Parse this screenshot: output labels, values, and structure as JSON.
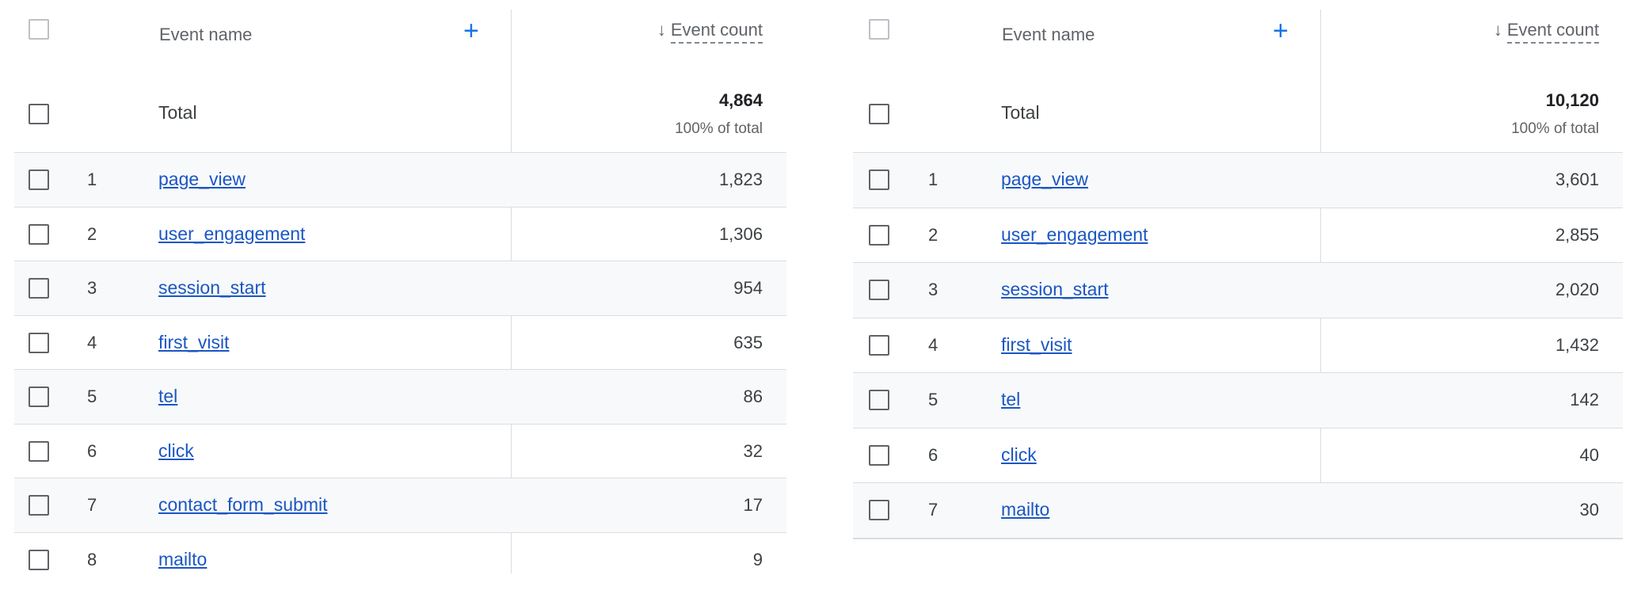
{
  "tables": [
    {
      "header": {
        "name_label": "Event name",
        "add_label": "+",
        "sort_arrow": "↓",
        "metric_label": "Event count"
      },
      "total": {
        "label": "Total",
        "value": "4,864",
        "percent": "100% of total"
      },
      "rows": [
        {
          "index": "1",
          "name": "page_view",
          "count": "1,823"
        },
        {
          "index": "2",
          "name": "user_engagement",
          "count": "1,306"
        },
        {
          "index": "3",
          "name": "session_start",
          "count": "954"
        },
        {
          "index": "4",
          "name": "first_visit",
          "count": "635"
        },
        {
          "index": "5",
          "name": "tel",
          "count": "86"
        },
        {
          "index": "6",
          "name": "click",
          "count": "32"
        },
        {
          "index": "7",
          "name": "contact_form_submit",
          "count": "17"
        },
        {
          "index": "8",
          "name": "mailto",
          "count": "9"
        }
      ]
    },
    {
      "header": {
        "name_label": "Event name",
        "add_label": "+",
        "sort_arrow": "↓",
        "metric_label": "Event count"
      },
      "total": {
        "label": "Total",
        "value": "10,120",
        "percent": "100% of total"
      },
      "rows": [
        {
          "index": "1",
          "name": "page_view",
          "count": "3,601"
        },
        {
          "index": "2",
          "name": "user_engagement",
          "count": "2,855"
        },
        {
          "index": "3",
          "name": "session_start",
          "count": "2,020"
        },
        {
          "index": "4",
          "name": "first_visit",
          "count": "1,432"
        },
        {
          "index": "5",
          "name": "tel",
          "count": "142"
        },
        {
          "index": "6",
          "name": "click",
          "count": "40"
        },
        {
          "index": "7",
          "name": "mailto",
          "count": "30"
        }
      ]
    }
  ],
  "colors": {
    "link": "#1a56c4",
    "accent": "#1a73e8",
    "shaded_row": "#f8f9fa",
    "border": "#dadce0"
  }
}
